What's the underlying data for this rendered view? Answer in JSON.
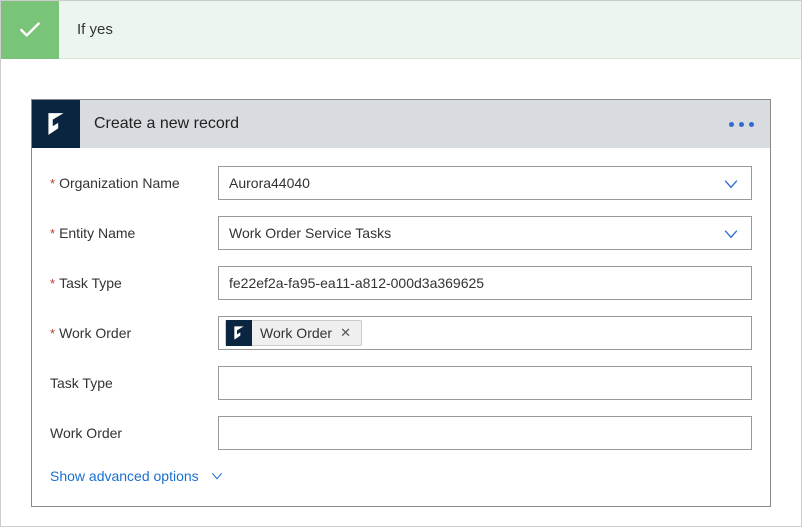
{
  "condition": {
    "title": "If yes"
  },
  "action": {
    "title": "Create a new record",
    "form": {
      "organization_name": {
        "label": "Organization Name",
        "required": true,
        "value": "Aurora44040",
        "type": "dropdown"
      },
      "entity_name": {
        "label": "Entity Name",
        "required": true,
        "value": "Work Order Service Tasks",
        "type": "dropdown"
      },
      "task_type_req": {
        "label": "Task Type",
        "required": true,
        "value": "fe22ef2a-fa95-ea11-a812-000d3a369625",
        "type": "text"
      },
      "work_order_req": {
        "label": "Work Order",
        "required": true,
        "token": "Work Order",
        "type": "token"
      },
      "task_type_opt": {
        "label": "Task Type",
        "required": false,
        "value": "",
        "type": "text"
      },
      "work_order_opt": {
        "label": "Work Order",
        "required": false,
        "value": "",
        "type": "text"
      }
    },
    "show_advanced": "Show advanced options"
  }
}
